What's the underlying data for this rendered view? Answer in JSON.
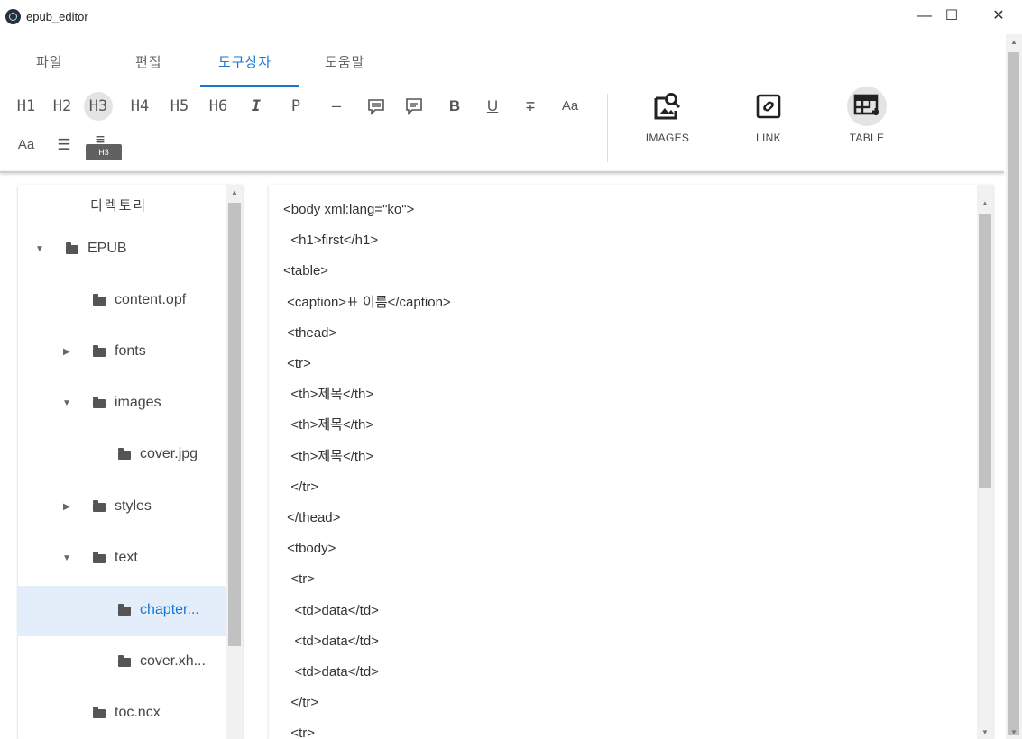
{
  "window": {
    "title": "epub_editor",
    "min": "—",
    "max": "☐",
    "close": "✕"
  },
  "menu": {
    "tabs": [
      "파일",
      "편집",
      "도구상자",
      "도움말"
    ],
    "active": "도구상자"
  },
  "toolbar": {
    "row1": [
      "H1",
      "H2",
      "H3",
      "H4",
      "H5",
      "H6",
      "I",
      "P",
      "—",
      "▤",
      "▭",
      "B",
      "U",
      "∓",
      "Aa"
    ],
    "row2": [
      "Aa",
      "☰",
      "≡"
    ],
    "tooltip": "H3",
    "big_buttons": [
      {
        "label": "IMAGES",
        "icon": "image-search-icon"
      },
      {
        "label": "LINK",
        "icon": "link-icon"
      },
      {
        "label": "TABLE",
        "icon": "table-plus-icon"
      }
    ]
  },
  "sidebar": {
    "title": "디렉토리",
    "items": [
      {
        "label": "EPUB",
        "caret": "▼"
      },
      {
        "label": "content.opf",
        "caret": ""
      },
      {
        "label": "fonts",
        "caret": "▶"
      },
      {
        "label": "images",
        "caret": "▼"
      },
      {
        "label": "cover.jpg",
        "caret": ""
      },
      {
        "label": "styles",
        "caret": "▶"
      },
      {
        "label": "text",
        "caret": "▼"
      },
      {
        "label": "chapter...",
        "caret": ""
      },
      {
        "label": "cover.xh...",
        "caret": ""
      },
      {
        "label": "toc.ncx",
        "caret": ""
      }
    ],
    "selected": "chapter..."
  },
  "editor": {
    "lines": [
      "<body xml:lang=\"ko\">",
      "  <h1>first</h1>",
      "<table>",
      " <caption>표 이름</caption>",
      " <thead>",
      " <tr>",
      "  <th>제목</th>",
      "  <th>제목</th>",
      "  <th>제목</th>",
      "  </tr>",
      " </thead>",
      " <tbody>",
      "  <tr>",
      "   <td>data</td>",
      "   <td>data</td>",
      "   <td>data</td>",
      "  </tr>",
      "  <tr>"
    ]
  }
}
